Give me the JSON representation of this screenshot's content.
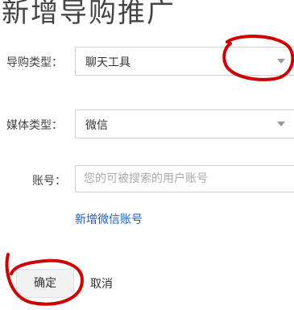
{
  "title": "新增导购推广",
  "form": {
    "guide_type": {
      "label": "导购类型：",
      "value": "聊天工具"
    },
    "media_type": {
      "label": "媒体类型：",
      "value": "微信"
    },
    "account": {
      "label": "账号：",
      "placeholder": "您的可被搜索的用户账号"
    },
    "add_link": "新增微信账号"
  },
  "buttons": {
    "confirm": "确定",
    "cancel": "取消"
  },
  "colors": {
    "annotation": "#cc0000",
    "link": "#1a5fb4"
  }
}
